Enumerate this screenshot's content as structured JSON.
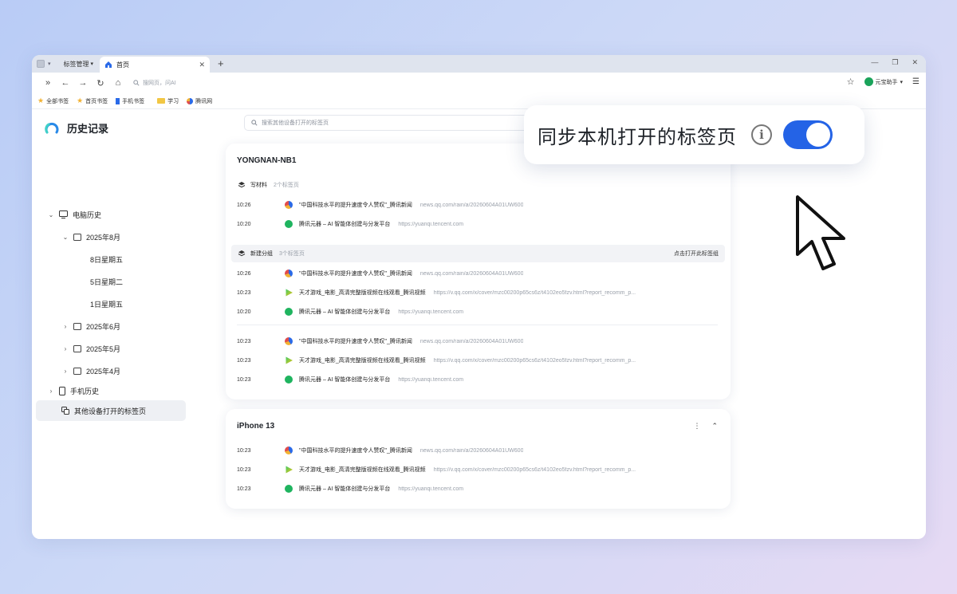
{
  "browser": {
    "manage_label": "标签管理",
    "tab_title": "首页",
    "omnibox_placeholder": "搜网页，问AI",
    "assistant_label": "元宝助手"
  },
  "bookmarks": [
    {
      "label": "全部书签",
      "icon": "star-icon"
    },
    {
      "label": "首页书签",
      "icon": "star-icon"
    },
    {
      "label": "手机书签",
      "icon": "bookmark-icon"
    },
    {
      "label": "学习",
      "icon": "folder-icon"
    },
    {
      "label": "腾讯网",
      "icon": "tencent-icon"
    }
  ],
  "sidebar": {
    "title": "历史记录",
    "pc_history": "电脑历史",
    "month_aug": "2025年8月",
    "day1": "8日星期五",
    "day2": "5日星期二",
    "day3": "1日星期五",
    "month_jun": "2025年6月",
    "month_may": "2025年5月",
    "month_apr": "2025年4月",
    "mobile_history": "手机历史",
    "other_devices": "其他设备打开的标签页"
  },
  "search": {
    "placeholder": "搜索其他设备打开的标签页"
  },
  "devices": {
    "d1": {
      "name": "YONGNAN-NB1",
      "g1": {
        "name": "写材料",
        "count": "2个标签页"
      },
      "g2": {
        "name": "新建分组",
        "count": "3个标签页",
        "open_label": "点击打开此标签组"
      },
      "rows_g1": [
        {
          "time": "10:26",
          "title": "\"中国科技水平的提升速度令人赞叹\"_腾讯新闻",
          "url": "news.qq.com/rain/a/20260604A01UW600"
        },
        {
          "time": "10:20",
          "title": "腾讯元器 – AI 智能体创建与分发平台",
          "url": "https://yuanqi.tencent.com"
        }
      ],
      "rows_g2": [
        {
          "time": "10:26",
          "title": "\"中国科技水平的提升速度令人赞叹\"_腾讯新闻",
          "url": "news.qq.com/rain/a/20260604A01UW600"
        },
        {
          "time": "10:23",
          "title": "天才游戏_电影_高清完整版视频在线观看_腾讯视频",
          "url": "https://v.qq.com/x/cover/mzc00200p65cs6z/t4102eo5fzv.html?report_recomm_p..."
        },
        {
          "time": "10:20",
          "title": "腾讯元器 – AI 智能体创建与分发平台",
          "url": "https://yuanqi.tencent.com"
        }
      ],
      "rows_loose": [
        {
          "time": "10:23",
          "title": "\"中国科技水平的提升速度令人赞叹\"_腾讯新闻",
          "url": "news.qq.com/rain/a/20260604A01UW600"
        },
        {
          "time": "10:23",
          "title": "天才游戏_电影_高清完整版视频在线观看_腾讯视频",
          "url": "https://v.qq.com/x/cover/mzc00200p65cs6z/t4102eo5fzv.html?report_recomm_p..."
        },
        {
          "time": "10:23",
          "title": "腾讯元器 – AI 智能体创建与分发平台",
          "url": "https://yuanqi.tencent.com"
        }
      ]
    },
    "d2": {
      "name": "iPhone 13",
      "rows": [
        {
          "time": "10:23",
          "title": "\"中国科技水平的提升速度令人赞叹\"_腾讯新闻",
          "url": "news.qq.com/rain/a/20260604A01UW600"
        },
        {
          "time": "10:23",
          "title": "天才游戏_电影_高清完整版视频在线观看_腾讯视频",
          "url": "https://v.qq.com/x/cover/mzc00200p65cs6z/t4102eo5fzv.html?report_recomm_p..."
        },
        {
          "time": "10:23",
          "title": "腾讯元器 – AI 智能体创建与分发平台",
          "url": "https://yuanqi.tencent.com"
        }
      ]
    }
  },
  "popup": {
    "text": "同步本机打开的标签页",
    "info_glyph": "i",
    "toggle_on": true
  },
  "colors": {
    "accent": "#2463e6",
    "background_start": "#b9ccf6",
    "background_end": "#e7daf4"
  }
}
